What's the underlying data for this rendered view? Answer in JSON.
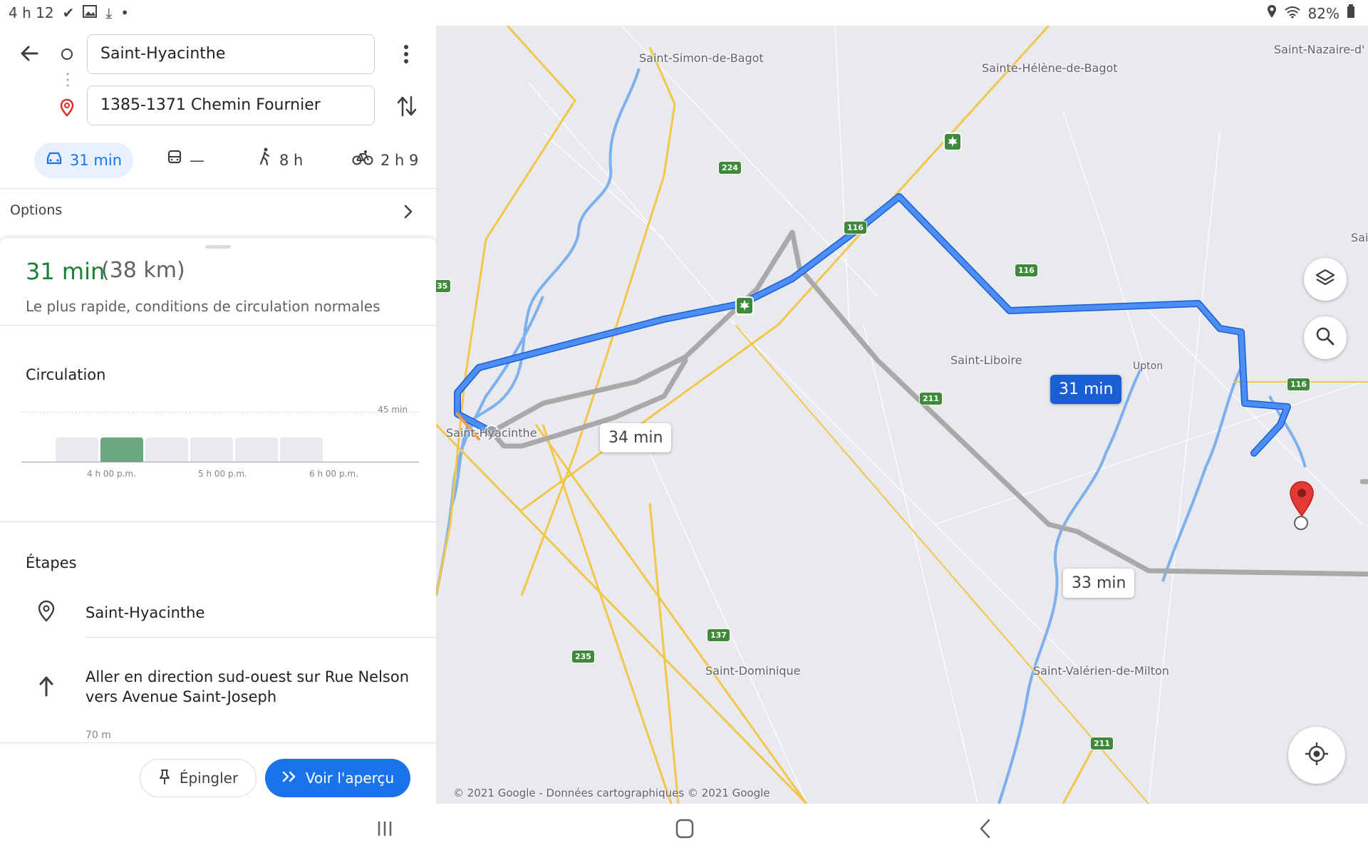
{
  "status_bar": {
    "time": "4 h 12",
    "battery": "82%"
  },
  "search": {
    "origin": "Saint-Hyacinthe",
    "destination": "1385-1371 Chemin Fournier"
  },
  "modes": {
    "car": "31 min",
    "transit": "—",
    "walk": "8 h",
    "bike": "2 h 9"
  },
  "options_label": "Options",
  "route": {
    "duration": "31 min",
    "distance": "(38 km)",
    "description": "Le plus rapide, conditions de circulation normales"
  },
  "traffic": {
    "title": "Circulation",
    "max_label": "45 min",
    "bars": [
      0.48,
      0.48,
      0.48,
      0.48,
      0.48,
      0.48
    ],
    "active_index": 1,
    "times": [
      "4 h 00 p.m.",
      "5 h 00 p.m.",
      "6 h 00 p.m."
    ]
  },
  "steps": {
    "title": "Étapes",
    "start": "Saint-Hyacinthe",
    "first_instruction": "Aller en direction sud-ouest sur Rue Nelson vers Avenue Saint-Joseph",
    "first_distance": "70 m"
  },
  "buttons": {
    "pin": "Épingler",
    "preview": "Voir l'aperçu"
  },
  "map": {
    "places": {
      "saint_simon": "Saint-Simon-de-Bagot",
      "sainte_helene": "Sainte-Hélène-de-Bagot",
      "saint_nazaire": "Saint-Nazaire-d'",
      "sai": "Sai",
      "saint_liboire": "Saint-Liboire",
      "upton": "Upton",
      "saint_hyacinthe": "Saint-Hyacinthe",
      "saint_dominique": "Saint-Dominique",
      "saint_valerien": "Saint-Valérien-de-Milton"
    },
    "shields": {
      "r224": "224",
      "r116a": "116",
      "r116b": "116",
      "r116c": "116",
      "r211a": "211",
      "r211b": "211",
      "r137": "137",
      "r235": "235",
      "r35": "35"
    },
    "bubbles": {
      "main": "31 min",
      "alt1": "34 min",
      "alt2": "33 min"
    },
    "copyright": "© 2021 Google - Données cartographiques © 2021 Google"
  },
  "colors": {
    "route": "#4c8df6",
    "alt_route": "#a9a9a9",
    "accent": "#1a73e8",
    "traffic_active": "#6aa97f"
  }
}
